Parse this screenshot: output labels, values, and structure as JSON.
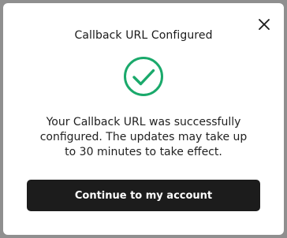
{
  "dialog": {
    "title": "Callback URL Configured",
    "message": "Your Callback URL was successfully configured. The updates may take up to 30 minutes to take effect.",
    "primary_button": "Continue to my account",
    "icons": {
      "close": "close-icon",
      "status": "check-circle-icon"
    },
    "colors": {
      "success": "#1aa96b",
      "button": "#1c1c1c"
    }
  }
}
